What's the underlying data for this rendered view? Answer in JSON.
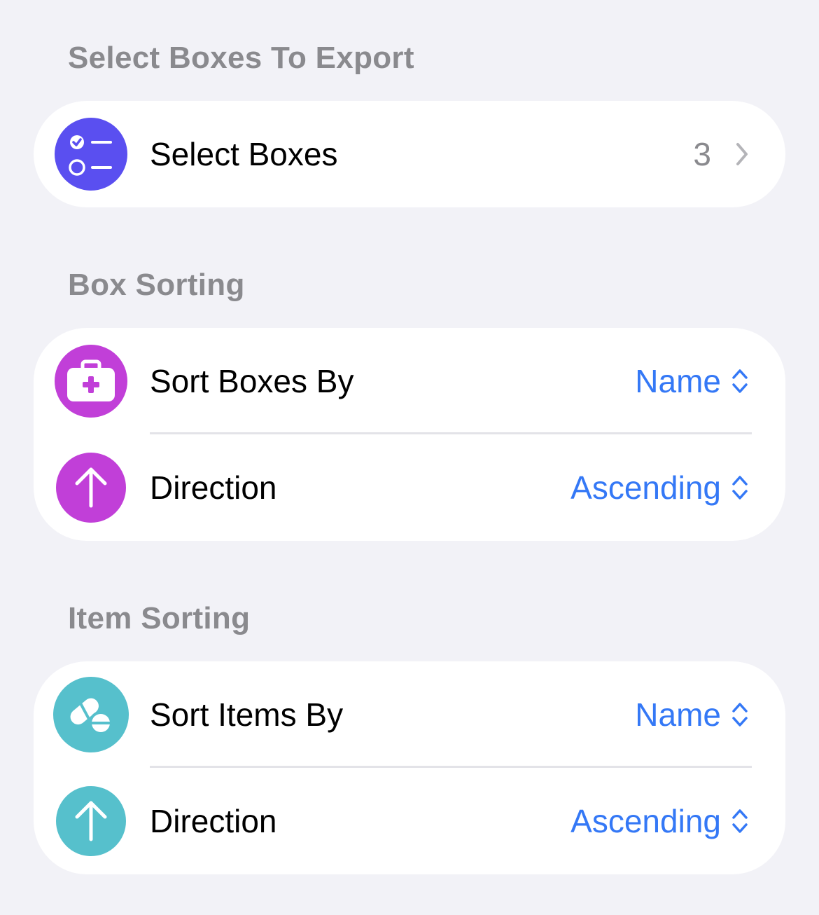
{
  "sections": {
    "export": {
      "header": "Select Boxes To Export",
      "select_boxes": {
        "label": "Select Boxes",
        "count": "3"
      }
    },
    "box_sorting": {
      "header": "Box Sorting",
      "sort_by": {
        "label": "Sort Boxes By",
        "value": "Name"
      },
      "direction": {
        "label": "Direction",
        "value": "Ascending"
      }
    },
    "item_sorting": {
      "header": "Item Sorting",
      "sort_by": {
        "label": "Sort Items By",
        "value": "Name"
      },
      "direction": {
        "label": "Direction",
        "value": "Ascending"
      }
    }
  },
  "icons": {
    "select_boxes": "checklist-icon",
    "sort_boxes": "medical-kit-icon",
    "box_direction": "arrow-up-icon",
    "sort_items": "pills-icon",
    "item_direction": "arrow-up-icon",
    "disclosure": "chevron-right-icon",
    "picker": "chevron-up-down-icon"
  },
  "colors": {
    "background": "#f2f2f7",
    "card": "#ffffff",
    "header_text": "#8a8a8e",
    "accent_blue": "#3478f6",
    "select_boxes_icon": "#5a4ff0",
    "box_sorting_icon": "#c13fd8",
    "item_sorting_icon": "#56c0cc"
  }
}
